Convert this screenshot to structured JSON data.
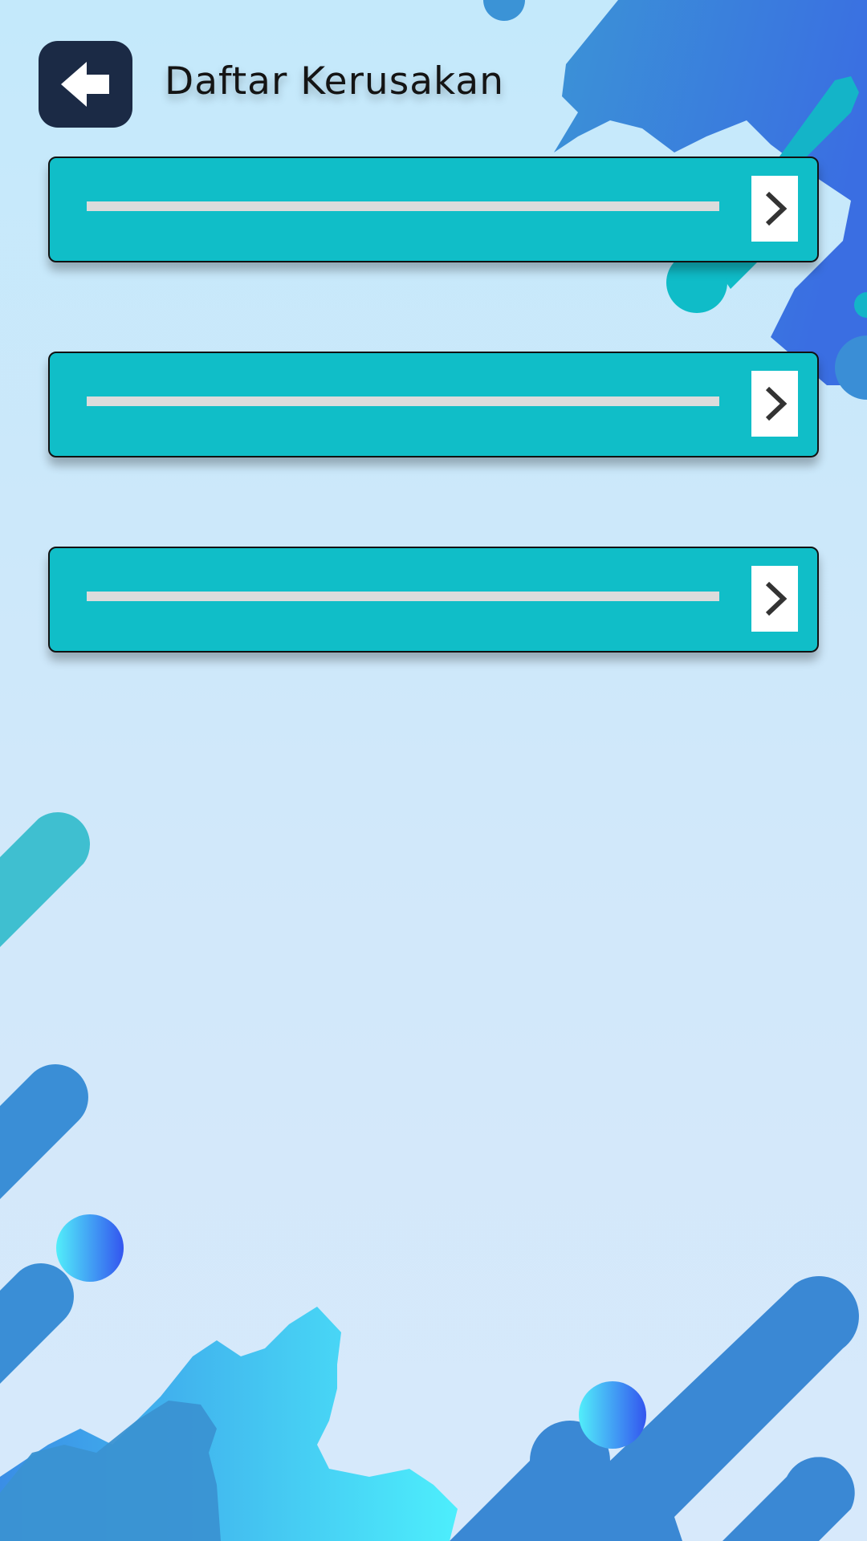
{
  "header": {
    "title": "Daftar Kerusakan",
    "back_icon": "arrow-left-icon"
  },
  "items": [
    {
      "label": "",
      "chevron_icon": "chevron-right-icon"
    },
    {
      "label": "",
      "chevron_icon": "chevron-right-icon"
    },
    {
      "label": "",
      "chevron_icon": "chevron-right-icon"
    }
  ],
  "colors": {
    "background": "#c4e9fb",
    "item_fill": "#10bec8",
    "back_button": "#1b2a45",
    "decor_blue": "#3a78e0",
    "decor_teal": "#14b4c8",
    "decor_cyan": "#4cdcf8"
  }
}
